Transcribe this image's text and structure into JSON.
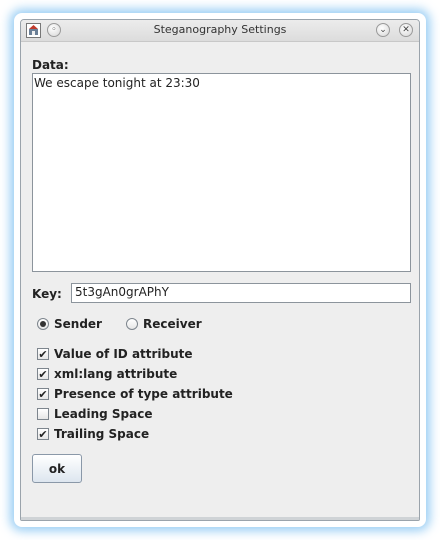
{
  "window": {
    "title": "Steganography Settings",
    "menu_glyph": "◦",
    "minimize_glyph": "⌄",
    "close_glyph": "✕"
  },
  "form": {
    "data_label": "Data:",
    "data_value": "We escape tonight at 23:30",
    "key_label": "Key:",
    "key_value": "5t3gAn0grAPhY"
  },
  "mode": {
    "options": [
      {
        "label": "Sender",
        "selected": true
      },
      {
        "label": "Receiver",
        "selected": false
      }
    ]
  },
  "attributes": [
    {
      "label": "Value of ID attribute",
      "checked": true
    },
    {
      "label": "xml:lang attribute",
      "checked": true
    },
    {
      "label": "Presence of type attribute",
      "checked": true
    },
    {
      "label": "Leading Space",
      "checked": false
    },
    {
      "label": "Trailing Space",
      "checked": true
    }
  ],
  "actions": {
    "ok_label": "ok"
  },
  "icons": {
    "app": "app-icon",
    "window_menu": "circle-icon",
    "minimize": "chevron-down-icon",
    "close": "close-icon",
    "check": "checkmark-icon"
  }
}
